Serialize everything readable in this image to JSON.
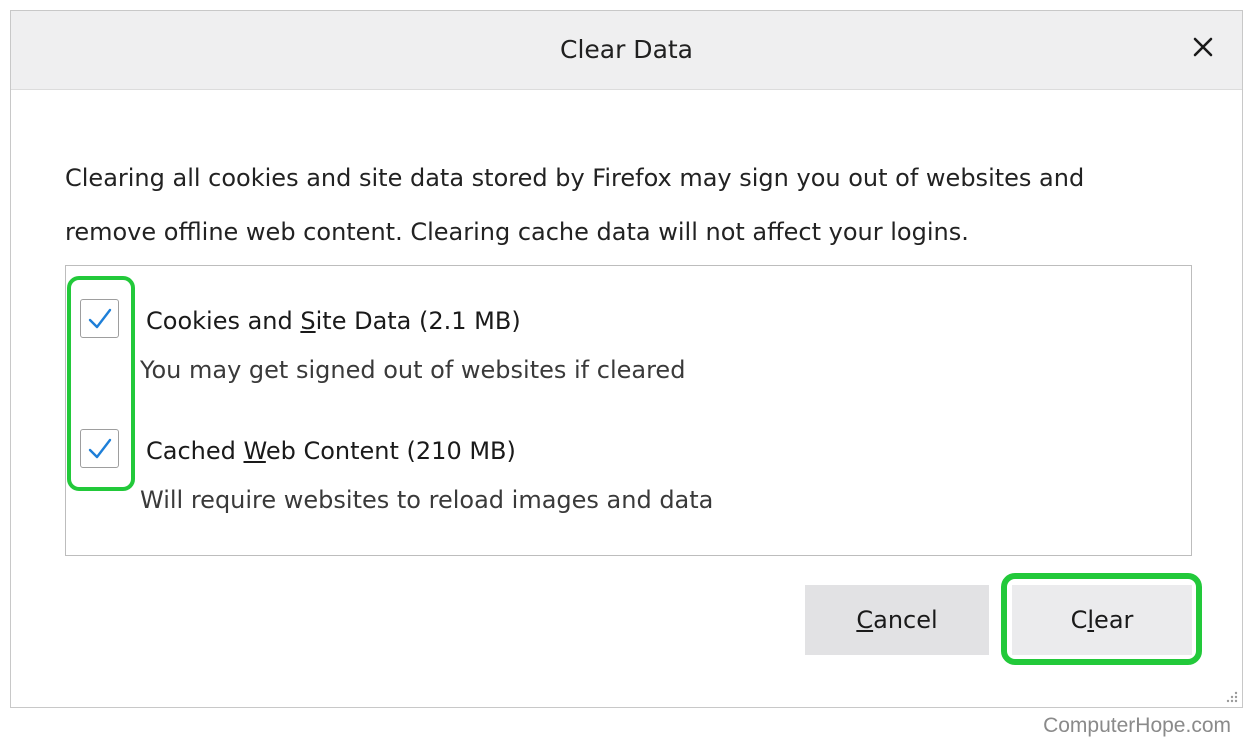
{
  "dialog": {
    "title": "Clear Data",
    "close_icon": "close-icon",
    "description_line1": "Clearing all cookies and site data stored by Firefox may sign you out of websites and",
    "description_line2": "remove offline web content. Clearing cache data will not affect your logins."
  },
  "options": [
    {
      "checked": true,
      "label_pre": "Cookies and ",
      "label_accel": "S",
      "label_post": "ite Data (2.1 MB)",
      "description": "You may get signed out of websites if cleared"
    },
    {
      "checked": true,
      "label_pre": "Cached ",
      "label_accel": "W",
      "label_post": "eb Content (210 MB)",
      "description": "Will require websites to reload images and data"
    }
  ],
  "buttons": {
    "cancel_accel": "C",
    "cancel_rest": "ancel",
    "clear_pre": "C",
    "clear_accel": "l",
    "clear_post": "ear"
  },
  "colors": {
    "highlight": "#22c93a",
    "checkmark": "#1e7fd8"
  },
  "watermark": "ComputerHope.com"
}
